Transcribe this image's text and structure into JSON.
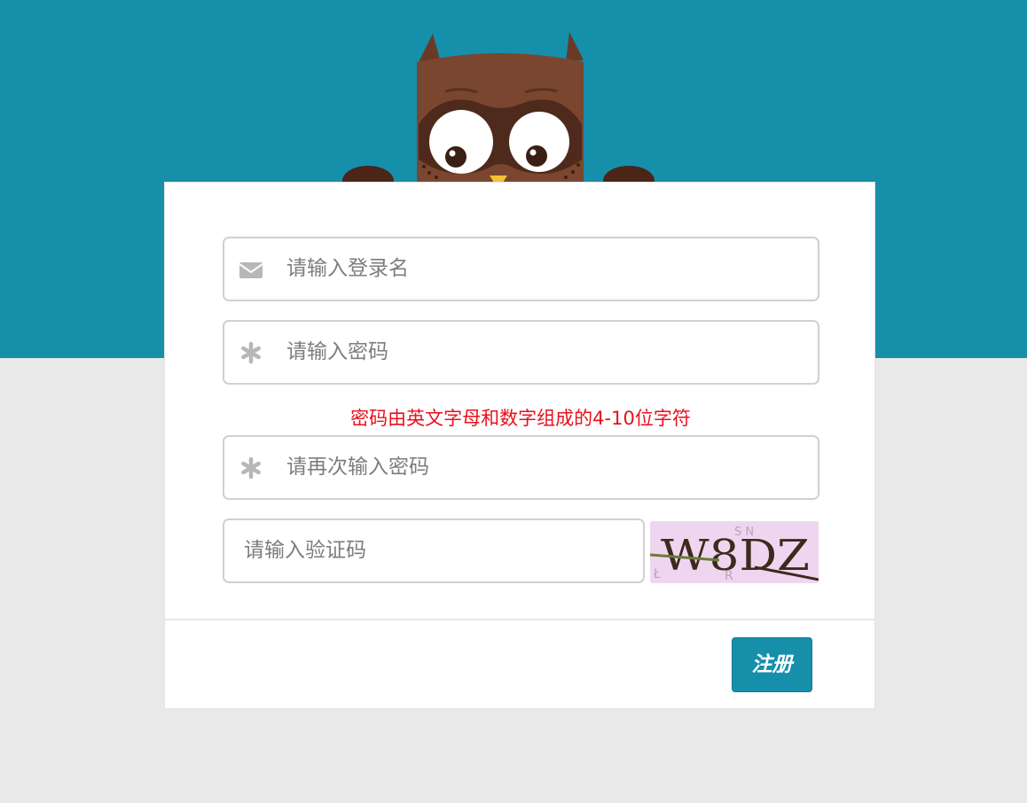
{
  "form": {
    "username_placeholder": "请输入登录名",
    "password_placeholder": "请输入密码",
    "password_hint": "密码由英文字母和数字组成的4-10位字符",
    "confirm_placeholder": "请再次输入密码",
    "captcha_placeholder": "请输入验证码",
    "captcha_text": "W8DZ",
    "register_label": "注册"
  },
  "icons": {
    "username": "envelope-icon",
    "password": "asterisk-icon",
    "confirm": "asterisk-icon"
  },
  "colors": {
    "brand": "#168fab",
    "page_background": "#e9e9e9",
    "hint": "#e8101d",
    "owl_body": "#7a4630"
  }
}
